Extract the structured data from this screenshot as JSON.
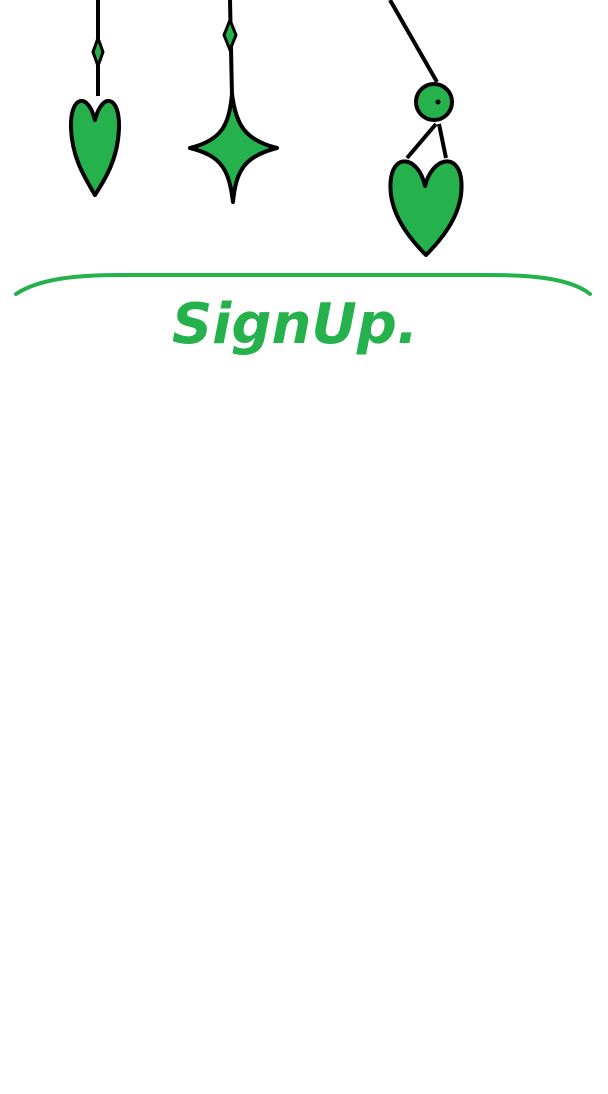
{
  "colors": {
    "accent": "#25b14b",
    "outline": "#000000",
    "background": "#ffffff"
  },
  "decorations": [
    {
      "icon": "heart-icon"
    },
    {
      "icon": "sparkle-star-icon"
    },
    {
      "icon": "hanging-heart-with-bead-icon"
    }
  ],
  "signup": {
    "title": "SignUp."
  }
}
